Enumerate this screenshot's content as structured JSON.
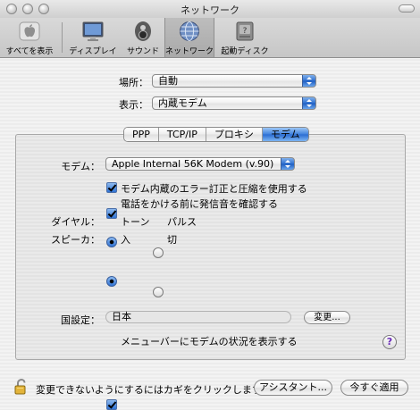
{
  "window": {
    "title": "ネットワーク"
  },
  "toolbar": {
    "items": [
      {
        "label": "すべてを表示",
        "icon": "apple-logo-icon"
      },
      {
        "label": "ディスプレイ",
        "icon": "display-icon"
      },
      {
        "label": "サウンド",
        "icon": "speaker-icon"
      },
      {
        "label": "ネットワーク",
        "icon": "network-globe-icon",
        "selected": true
      },
      {
        "label": "起動ディスク",
        "icon": "startup-disk-icon"
      }
    ]
  },
  "location": {
    "label": "場所：",
    "value": "自動"
  },
  "show": {
    "label": "表示：",
    "value": "内蔵モデム"
  },
  "tabs": [
    {
      "label": "PPP"
    },
    {
      "label": "TCP/IP"
    },
    {
      "label": "プロキシ"
    },
    {
      "label": "モデム",
      "active": true
    }
  ],
  "modem": {
    "label": "モデム：",
    "value": "Apple Internal 56K Modem (v.90)",
    "error_correction": {
      "label": "モデム内蔵のエラー訂正と圧縮を使用する",
      "checked": true
    },
    "dial_tone": {
      "label": "電話をかける前に発信音を確認する",
      "checked": true
    },
    "dialing": {
      "label": "ダイヤル：",
      "options": [
        "トーン",
        "パルス"
      ],
      "selected": "トーン"
    },
    "speaker": {
      "label": "スピーカ：",
      "options": [
        "入",
        "切"
      ],
      "selected": "入"
    }
  },
  "country": {
    "label": "国設定：",
    "value": "日本",
    "change_button": "変更..."
  },
  "menubar_status": {
    "label": "メニューバーにモデムの状況を表示する",
    "checked": true
  },
  "footer": {
    "lock_text": "変更できないようにするにはカギをクリックします。",
    "assistant_button": "アシスタント...",
    "apply_button": "今すぐ適用"
  },
  "colors": {
    "accent": "#2f72d4",
    "help": "#6a2ab8"
  }
}
